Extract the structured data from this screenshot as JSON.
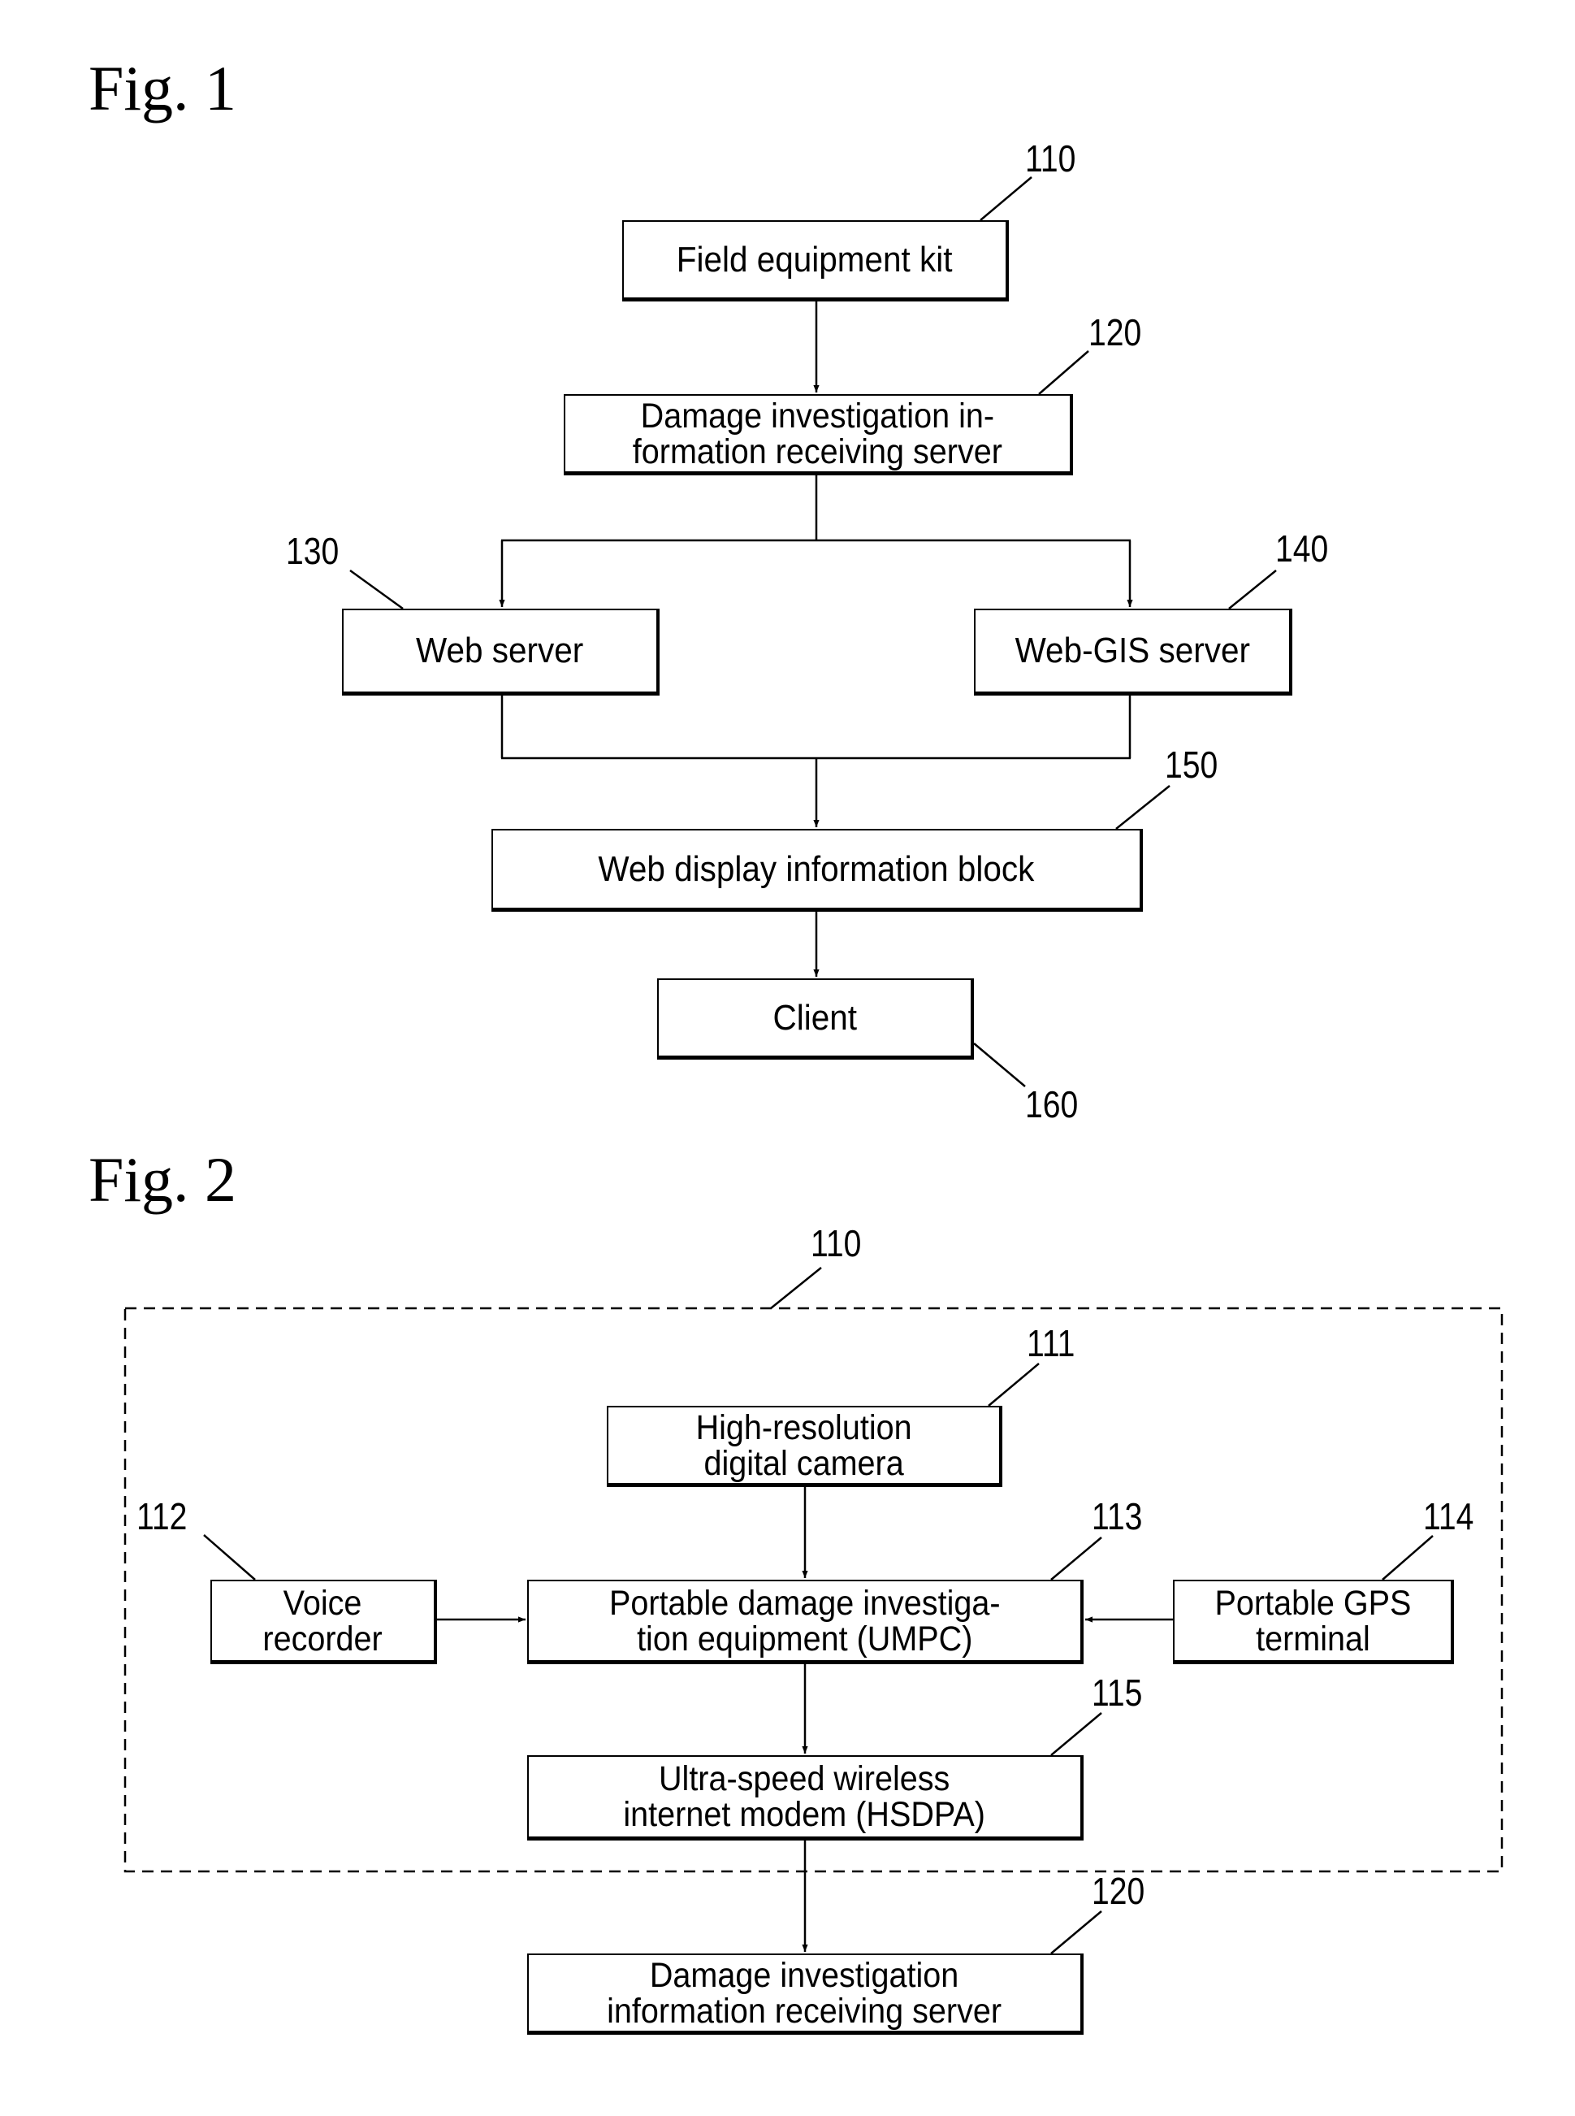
{
  "figures": [
    {
      "title": "Fig. 1",
      "blocks": {
        "b110": {
          "ref": "110",
          "label": "Field equipment kit"
        },
        "b120": {
          "ref": "120",
          "label": "Damage investigation in-\nformation receiving server"
        },
        "b130": {
          "ref": "130",
          "label": "Web server"
        },
        "b140": {
          "ref": "140",
          "label": "Web-GIS server"
        },
        "b150": {
          "ref": "150",
          "label": "Web display information block"
        },
        "b160": {
          "ref": "160",
          "label": "Client"
        }
      },
      "connections": [
        [
          "110",
          "120"
        ],
        [
          "120",
          "130"
        ],
        [
          "120",
          "140"
        ],
        [
          "130",
          "150"
        ],
        [
          "140",
          "150"
        ],
        [
          "150",
          "160"
        ]
      ]
    },
    {
      "title": "Fig. 2",
      "group": {
        "ref": "110"
      },
      "blocks": {
        "b111": {
          "ref": "111",
          "label": "High-resolution\ndigital camera"
        },
        "b112": {
          "ref": "112",
          "label": "Voice\nrecorder"
        },
        "b113": {
          "ref": "113",
          "label": "Portable damage investiga-\ntion equipment (UMPC)"
        },
        "b114": {
          "ref": "114",
          "label": "Portable GPS\nterminal"
        },
        "b115": {
          "ref": "115",
          "label": "Ultra-speed wireless\ninternet modem (HSDPA)"
        },
        "b120": {
          "ref": "120",
          "label": "Damage investigation\ninformation receiving server"
        }
      },
      "connections": [
        [
          "111",
          "113"
        ],
        [
          "112",
          "113"
        ],
        [
          "114",
          "113"
        ],
        [
          "113",
          "115"
        ],
        [
          "115",
          "120"
        ]
      ]
    }
  ]
}
